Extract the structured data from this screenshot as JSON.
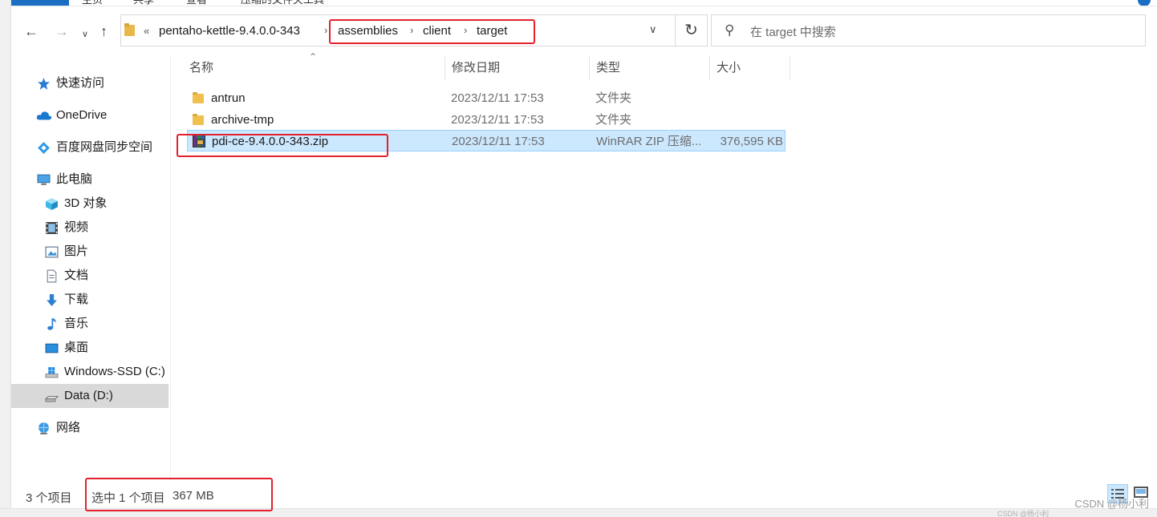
{
  "ribbon": {
    "tabs": [
      "主页",
      "共享",
      "查看",
      "压缩的文件夹工具"
    ]
  },
  "address": {
    "overflow": "«",
    "parent": "pentaho-kettle-9.4.0.0-343",
    "segments": [
      "assemblies",
      "client",
      "target"
    ]
  },
  "search": {
    "placeholder": "在 target 中搜索"
  },
  "sidebar": {
    "items": [
      {
        "label": "快速访问",
        "icon": "star-icon"
      },
      {
        "label": "OneDrive",
        "icon": "cloud-icon"
      },
      {
        "label": "百度网盘同步空间",
        "icon": "baidu-netdisk-icon"
      },
      {
        "label": "此电脑",
        "icon": "computer-icon"
      },
      {
        "label": "3D 对象",
        "icon": "cube-icon"
      },
      {
        "label": "视频",
        "icon": "film-icon"
      },
      {
        "label": "图片",
        "icon": "picture-icon"
      },
      {
        "label": "文档",
        "icon": "document-icon"
      },
      {
        "label": "下载",
        "icon": "download-icon"
      },
      {
        "label": "音乐",
        "icon": "music-icon"
      },
      {
        "label": "桌面",
        "icon": "desktop-icon"
      },
      {
        "label": "Windows-SSD (C:)",
        "icon": "windows-drive-icon"
      },
      {
        "label": "Data (D:)",
        "icon": "drive-icon"
      },
      {
        "label": "网络",
        "icon": "network-icon"
      }
    ]
  },
  "columns": {
    "name": "名称",
    "date": "修改日期",
    "type": "类型",
    "size": "大小"
  },
  "files": [
    {
      "name": "antrun",
      "date": "2023/12/11 17:53",
      "type": "文件夹",
      "size": ""
    },
    {
      "name": "archive-tmp",
      "date": "2023/12/11 17:53",
      "type": "文件夹",
      "size": ""
    },
    {
      "name": "pdi-ce-9.4.0.0-343.zip",
      "date": "2023/12/11 17:53",
      "type": "WinRAR ZIP 压缩...",
      "size": "376,595 KB"
    }
  ],
  "status": {
    "count": "3 个项目",
    "selection": "选中 1 个项目",
    "selection_size": "367 MB"
  },
  "watermark": "CSDN @杨小利",
  "tiny_watermark": "CSDN @杨小利",
  "colors": {
    "selection": "#cce8ff",
    "annotation": "#e3202b",
    "ribbon_file": "#1a6fc4"
  }
}
